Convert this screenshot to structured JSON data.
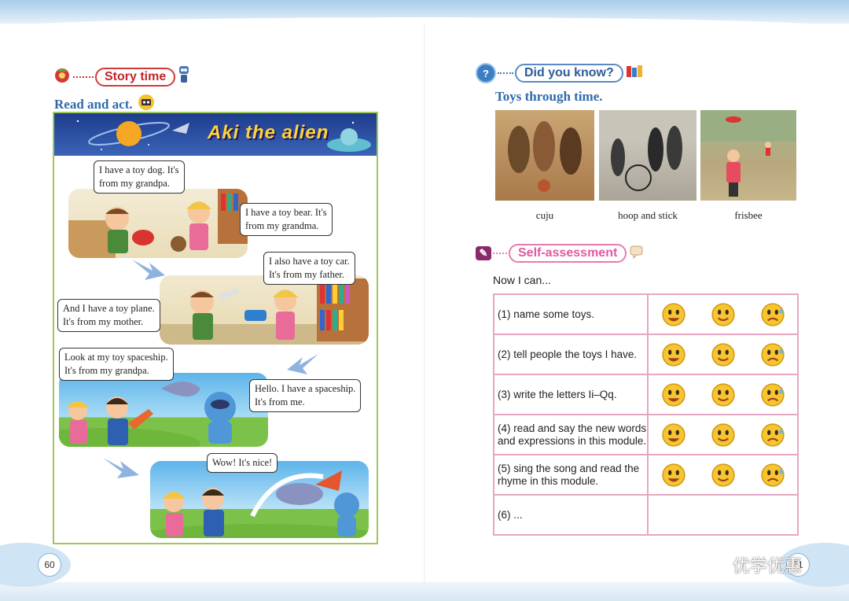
{
  "left_page": {
    "section_label": "Story time",
    "instruction": "Read and act.",
    "comic_title": "Aki the alien",
    "bubbles": [
      "I have a toy dog. It's\nfrom my grandpa.",
      "I have a toy bear. It's\nfrom my grandma.",
      "I also have a toy car.\nIt's from my father.",
      "And I have a toy plane.\nIt's from my mother.",
      "Look at my toy spaceship.\nIt's from my grandpa.",
      "Hello. I have a spaceship.\nIt's from me.",
      "Wow! It's nice!"
    ],
    "page_number": "60"
  },
  "right_page": {
    "section_label": "Did you know?",
    "subtitle": "Toys through time.",
    "photos": [
      {
        "caption": "cuju"
      },
      {
        "caption": "hoop and stick"
      },
      {
        "caption": "frisbee"
      }
    ],
    "self_assessment_label": "Self-assessment",
    "intro": "Now I can...",
    "rows": [
      {
        "num": "(1)",
        "text": "name some toys."
      },
      {
        "num": "(2)",
        "text": "tell people the toys I have."
      },
      {
        "num": "(3)",
        "text": "write the letters Ii–Qq."
      },
      {
        "num": "(4)",
        "text": "read and say the new words and expressions in this module."
      },
      {
        "num": "(5)",
        "text": "sing the song and read the rhyme in this module."
      },
      {
        "num": "(6)",
        "text": "..."
      }
    ],
    "page_number": "61",
    "watermark": "优学优惠"
  },
  "colors": {
    "accent_red": "#c0262b",
    "accent_blue": "#2f6aa8",
    "table_border": "#e7a7c4",
    "comic_border": "#9ec85a"
  },
  "icons": [
    "bell-icon",
    "robot-icon",
    "cassette-icon",
    "question-icon",
    "books-icon",
    "self-assessment-icon",
    "chat-icon"
  ]
}
